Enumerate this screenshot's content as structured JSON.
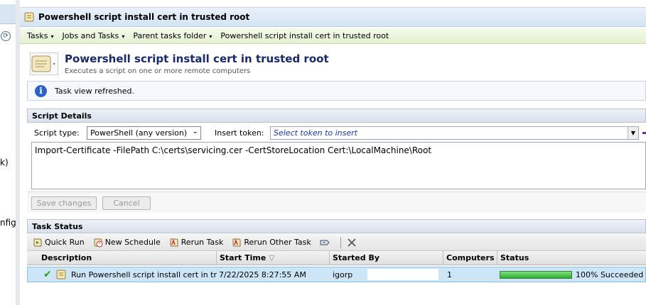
{
  "left_strip": {
    "texts": [
      "k)",
      "nfig"
    ]
  },
  "titlebar": {
    "title": "Powershell script install cert in trusted root"
  },
  "breadcrumb": [
    {
      "label": "Tasks",
      "caret": "▾"
    },
    {
      "label": "Jobs and Tasks",
      "caret": "▾"
    },
    {
      "label": "Parent tasks folder",
      "caret": "▾"
    },
    {
      "label": "Powershell script install cert in trusted root",
      "caret": ""
    }
  ],
  "header": {
    "title": "Powershell script install cert in trusted root",
    "subtitle": "Executes a script on one or more remote computers",
    "icon": "script-scroll-icon"
  },
  "info": {
    "text": "Task view refreshed.",
    "icon": "info-icon"
  },
  "script_details": {
    "section_title": "Script Details",
    "script_type_label": "Script type:",
    "script_type_value": "PowerShell (any version)",
    "insert_token_label": "Insert token:",
    "insert_token_placeholder": "Select token to insert",
    "script_text": "Import-Certificate -FilePath C:\\certs\\servicing.cer -CertStoreLocation Cert:\\LocalMachine\\Root",
    "save_label": "Save changes",
    "cancel_label": "Cancel"
  },
  "task_status": {
    "section_title": "Task Status",
    "toolbar": {
      "quick_run": "Quick Run",
      "new_schedule": "New Schedule",
      "rerun_task": "Rerun Task",
      "rerun_other_task": "Rerun Other Task"
    },
    "columns": {
      "description": "Description",
      "start_time": "Start Time",
      "started_by": "Started By",
      "computers": "Computers",
      "status": "Status"
    },
    "rows": [
      {
        "description": "Run Powershell script install cert in tr",
        "start_time": "7/22/2025 8:27:55 AM",
        "started_by": "igorp",
        "computers": "1",
        "status": "100% Succeeded",
        "progress": 1.0
      }
    ]
  },
  "colors": {
    "title_text": "#1a2a66",
    "info_icon": "#2b63c2",
    "progress_green": "#2fae2f",
    "selected_row": "#cde6f7"
  }
}
